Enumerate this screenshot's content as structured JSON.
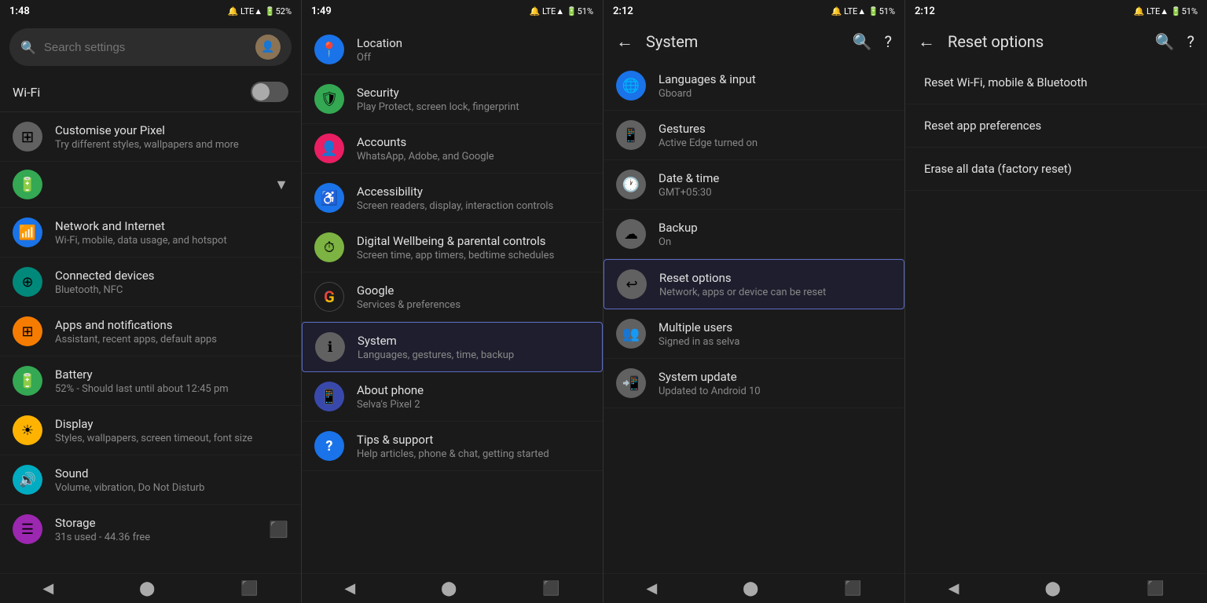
{
  "panel1": {
    "status": {
      "time": "1:48",
      "icons": "🔔 LTE▲ 🔋52%"
    },
    "search": {
      "placeholder": "Search settings"
    },
    "wifi": {
      "label": "Wi-Fi"
    },
    "customize": {
      "title": "Customise your Pixel",
      "sub": "Try different styles, wallpapers and more"
    },
    "battery_collapse": {
      "title": "🔋"
    },
    "items": [
      {
        "title": "Network and Internet",
        "sub": "Wi-Fi, mobile, data usage, and hotspot",
        "icon": "📶",
        "color": "icon-blue"
      },
      {
        "title": "Connected devices",
        "sub": "Bluetooth, NFC",
        "icon": "⊕",
        "color": "icon-teal"
      },
      {
        "title": "Apps and notifications",
        "sub": "Assistant, recent apps, default apps",
        "icon": "⊞",
        "color": "icon-orange"
      },
      {
        "title": "Battery",
        "sub": "52% - Should last until about 12:45 pm",
        "icon": "🔋",
        "color": "icon-green"
      },
      {
        "title": "Display",
        "sub": "Styles, wallpapers, screen timeout, font size",
        "icon": "☀",
        "color": "icon-amber"
      },
      {
        "title": "Sound",
        "sub": "Volume, vibration, Do Not Disturb",
        "icon": "🔊",
        "color": "icon-cyan"
      },
      {
        "title": "Storage",
        "sub": "31s used - 44.36 free",
        "icon": "☰",
        "color": "icon-purple"
      }
    ]
  },
  "panel2": {
    "status": {
      "time": "1:49",
      "icons": "🔔 LTE▲ 🔋51%"
    },
    "items": [
      {
        "title": "Location",
        "sub": "Off",
        "icon": "📍",
        "color": "icon-blue"
      },
      {
        "title": "Security",
        "sub": "Play Protect, screen lock, fingerprint",
        "icon": "🛡",
        "color": "icon-green"
      },
      {
        "title": "Accounts",
        "sub": "WhatsApp, Adobe, and Google",
        "icon": "👤",
        "color": "icon-pink"
      },
      {
        "title": "Accessibility",
        "sub": "Screen readers, display, interaction controls",
        "icon": "♿",
        "color": "icon-blue"
      },
      {
        "title": "Digital Wellbeing & parental controls",
        "sub": "Screen time, app timers, bedtime schedules",
        "icon": "⏱",
        "color": "icon-lime"
      },
      {
        "title": "Google",
        "sub": "Services & preferences",
        "icon": "G",
        "color": "icon-google"
      },
      {
        "title": "System",
        "sub": "Languages, gestures, time, backup",
        "icon": "ℹ",
        "color": "icon-gray"
      },
      {
        "title": "About phone",
        "sub": "Selva's Pixel 2",
        "icon": "📱",
        "color": "icon-darkblue"
      },
      {
        "title": "Tips & support",
        "sub": "Help articles, phone & chat, getting started",
        "icon": "?",
        "color": "icon-blue"
      }
    ]
  },
  "panel3": {
    "status": {
      "time": "2:12",
      "icons": "🔔 LTE▲ 🔋51%"
    },
    "title": "System",
    "items": [
      {
        "title": "Languages & input",
        "sub": "Gboard",
        "icon": "🌐",
        "color": "icon-blue"
      },
      {
        "title": "Gestures",
        "sub": "Active Edge turned on",
        "icon": "📱",
        "color": "icon-gray"
      },
      {
        "title": "Date & time",
        "sub": "GMT+05:30",
        "icon": "🕐",
        "color": "icon-gray"
      },
      {
        "title": "Backup",
        "sub": "On",
        "icon": "☁",
        "color": "icon-gray"
      },
      {
        "title": "Reset options",
        "sub": "Network, apps or device can be reset",
        "icon": "↩",
        "color": "icon-gray",
        "selected": true
      },
      {
        "title": "Multiple users",
        "sub": "Signed in as selva",
        "icon": "👥",
        "color": "icon-gray"
      },
      {
        "title": "System update",
        "sub": "Updated to Android 10",
        "icon": "📲",
        "color": "icon-gray"
      }
    ]
  },
  "panel4": {
    "status": {
      "time": "2:12",
      "icons": "🔔 LTE▲ 🔋51%"
    },
    "title": "Reset options",
    "items": [
      {
        "label": "Reset Wi-Fi, mobile & Bluetooth"
      },
      {
        "label": "Reset app preferences"
      },
      {
        "label": "Erase all data (factory reset)"
      }
    ]
  }
}
